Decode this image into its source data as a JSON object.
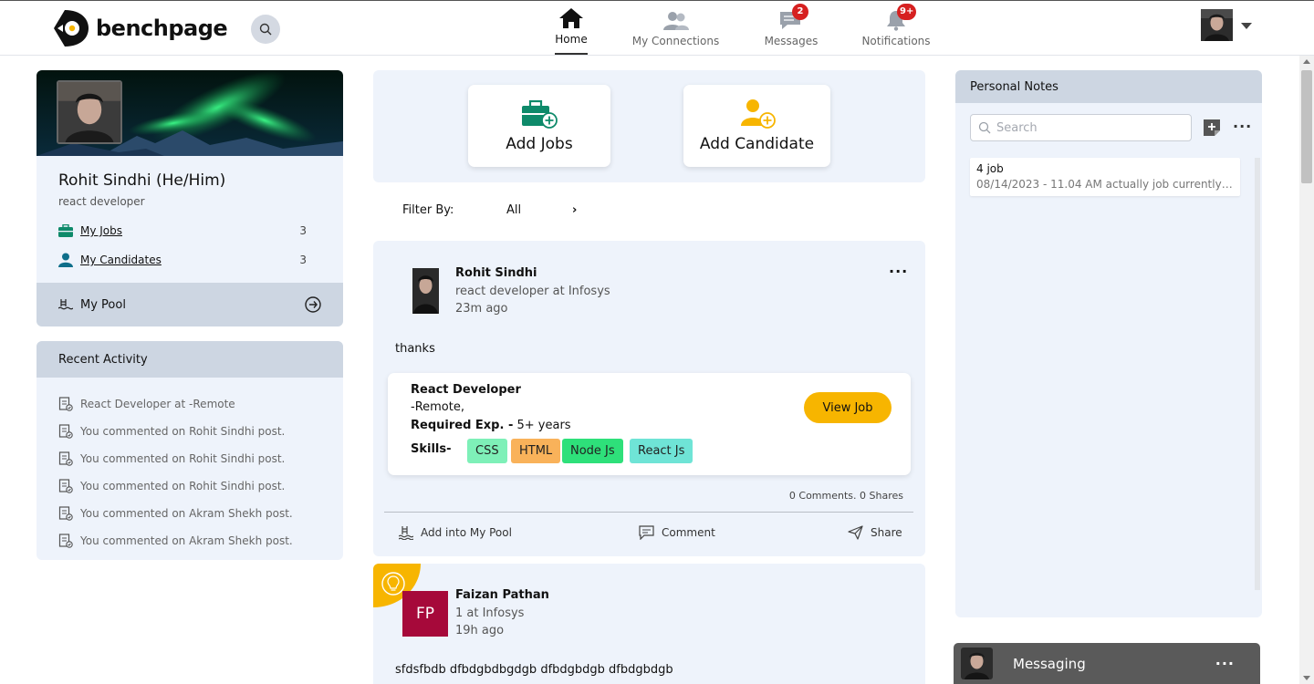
{
  "brand": {
    "name": "benchpage"
  },
  "nav": {
    "items": [
      {
        "label": "Home",
        "icon": "home-icon",
        "active": true
      },
      {
        "label": "My Connections",
        "icon": "connections-icon"
      },
      {
        "label": "Messages",
        "icon": "messages-icon",
        "badge": "2"
      },
      {
        "label": "Notifications",
        "icon": "bell-icon",
        "badge": "9+"
      }
    ]
  },
  "profile": {
    "name": "Rohit Sindhi (He/Him)",
    "role": "react developer",
    "stats": [
      {
        "label": "My Jobs",
        "count": "3",
        "icon": "briefcase-icon"
      },
      {
        "label": "My Candidates",
        "count": "3",
        "icon": "person-icon"
      }
    ],
    "pool_label": "My Pool"
  },
  "activity": {
    "title": "Recent Activity",
    "items": [
      "React Developer at -Remote",
      "You commented on Rohit Sindhi post.",
      "You commented on Rohit Sindhi post.",
      "You commented on Rohit Sindhi post.",
      "You commented on Akram Shekh post.",
      "You commented on Akram Shekh post."
    ]
  },
  "actions": {
    "add_jobs": "Add Jobs",
    "add_candidate": "Add Candidate"
  },
  "filter": {
    "label": "Filter By:",
    "value": "All",
    "chevron": "›"
  },
  "post1": {
    "author": "Rohit Sindhi",
    "subtitle": "react developer at Infosys",
    "time": "23m ago",
    "more": "···",
    "text": "thanks",
    "job": {
      "title": "React Developer",
      "location": "-Remote,",
      "exp_label": "Required Exp. -",
      "exp_value": "5+ years",
      "skills_label": "Skills-",
      "skills": [
        {
          "name": "CSS",
          "color": "#7ef0b8"
        },
        {
          "name": "HTML",
          "color": "#f9b25a"
        },
        {
          "name": "Node Js",
          "color": "#2ee07a"
        },
        {
          "name": "React Js",
          "color": "#6fe4d6"
        }
      ],
      "view_label": "View Job"
    },
    "stats": "0 Comments.  0 Shares",
    "actions": {
      "pool": "Add into My Pool",
      "comment": "Comment",
      "share": "Share"
    }
  },
  "post2": {
    "initials": "FP",
    "author": "Faizan Pathan",
    "subtitle": "1 at Infosys",
    "time": "19h ago",
    "text": "sfdsfbdb dfbdgbdbgdgb dfbdgbdgb dfbdgbdgb"
  },
  "notes": {
    "title": "Personal Notes",
    "search_placeholder": "Search",
    "more": "···",
    "items": [
      {
        "title": "4 job",
        "meta": "08/14/2023 - 11.04 AM actually job currently n..."
      }
    ]
  },
  "messaging": {
    "label": "Messaging",
    "more": "···"
  },
  "colors": {
    "accent": "#f7b500",
    "teal": "#0e8a6a",
    "card_bg": "#eef3fb",
    "card_head": "#cdd6e2",
    "badge": "#d62020",
    "fp_avatar": "#a6093a"
  }
}
